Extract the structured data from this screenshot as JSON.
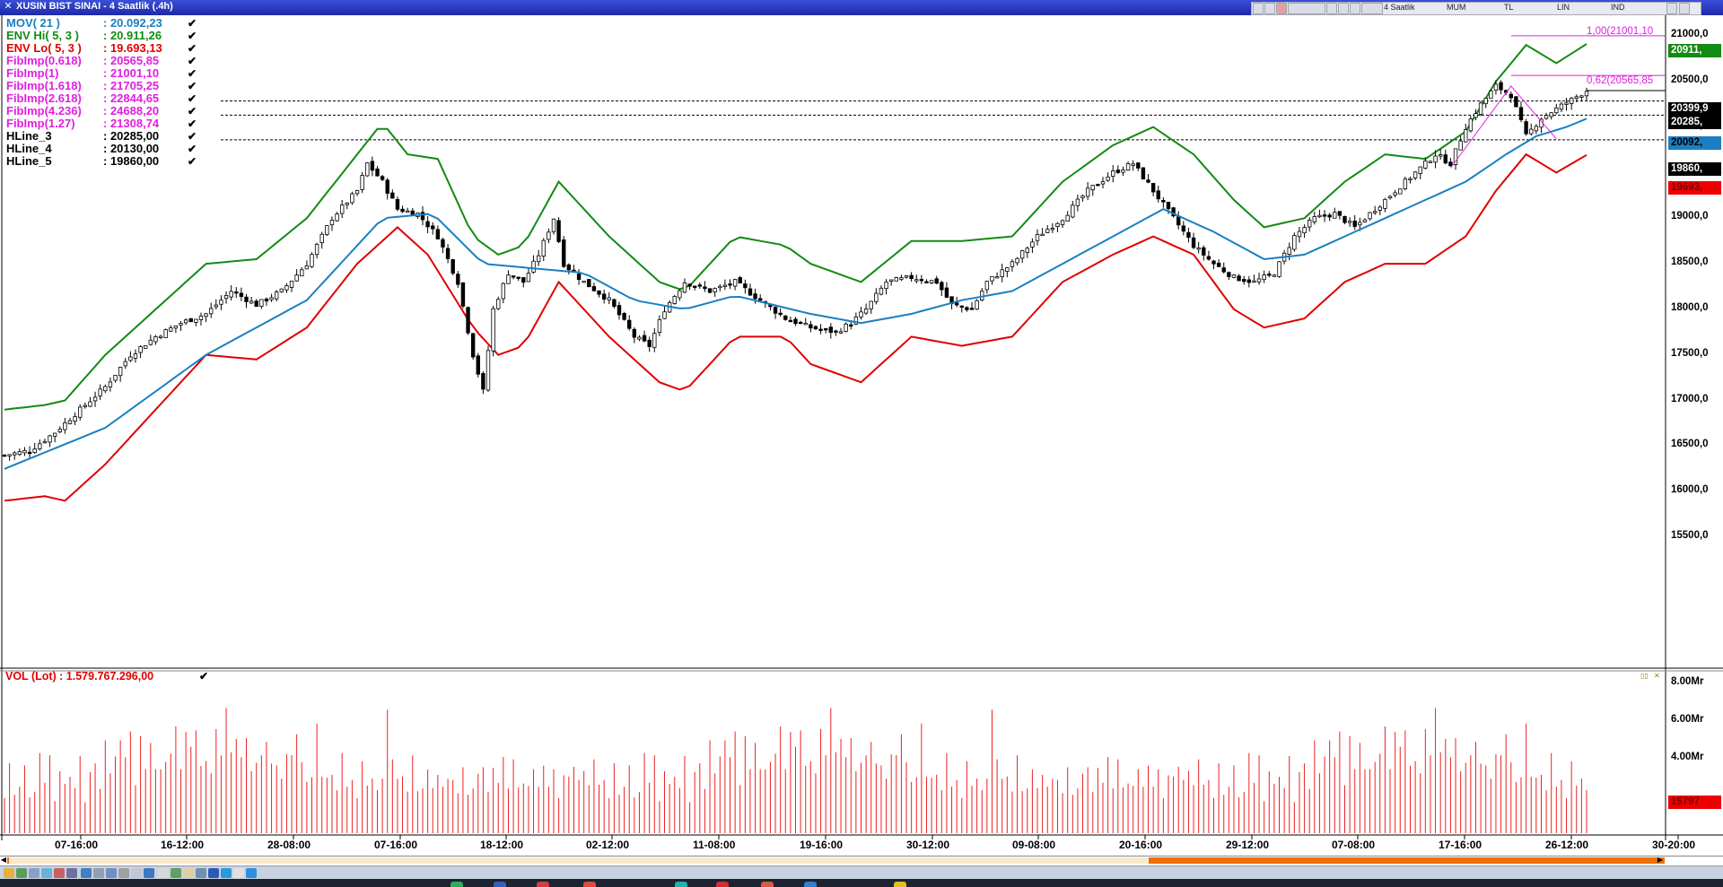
{
  "window": {
    "title": "XUSIN BIST SINAI - 4 Saatlik (.4h)",
    "toolbar_labels": [
      "4 Saatlik",
      "MUM",
      "TL",
      "LIN",
      "IND"
    ]
  },
  "legend": [
    {
      "label": "MOV( 21 )",
      "value": ": 20.092,23",
      "color": "#1a7fc2"
    },
    {
      "label": "ENV Hi( 5, 3 )",
      "value": ": 20.911,26",
      "color": "#138a13"
    },
    {
      "label": "ENV Lo( 5, 3 )",
      "value": ": 19.693,13",
      "color": "#e00000"
    },
    {
      "label": "FibImp(0.618)",
      "value": ": 20565,85",
      "color": "#e020e0"
    },
    {
      "label": "FibImp(1)",
      "value": ": 21001,10",
      "color": "#e020e0"
    },
    {
      "label": "FibImp(1.618)",
      "value": ": 21705,25",
      "color": "#e020e0"
    },
    {
      "label": "FibImp(2.618)",
      "value": ": 22844,65",
      "color": "#e020e0"
    },
    {
      "label": "FibImp(4.236)",
      "value": ": 24688,20",
      "color": "#e020e0"
    },
    {
      "label": "FibImp(1.27)",
      "value": ": 21308,74",
      "color": "#e020e0"
    },
    {
      "label": "HLine_3",
      "value": ": 20285,00",
      "color": "#000000"
    },
    {
      "label": "HLine_4",
      "value": ": 20130,00",
      "color": "#000000"
    },
    {
      "label": "HLine_5",
      "value": ": 19860,00",
      "color": "#000000"
    }
  ],
  "fib_labels": [
    "1,00(21001,10",
    "0,62(20565,85"
  ],
  "price_boxes": [
    {
      "text": "20911,",
      "bg": "#138a13",
      "fg": "#ffffff"
    },
    {
      "text": "20399,9",
      "bg": "#000000",
      "fg": "#ffffff"
    },
    {
      "text": "20285,",
      "bg": "#000000",
      "fg": "#ffffff"
    },
    {
      "text": "20092,",
      "bg": "#1a7fc2",
      "fg": "#000000"
    },
    {
      "text": "19860,",
      "bg": "#000000",
      "fg": "#ffffff"
    },
    {
      "text": "19693,",
      "bg": "#ee0000",
      "fg": "#7a0000"
    }
  ],
  "volume": {
    "legend": "VOL (Lot) : 1.579.767.296,00",
    "axis_labels": [
      "8.00Mr",
      "6.00Mr",
      "4.00Mr"
    ],
    "last_box": "15797"
  },
  "chart_data": {
    "type": "candlestick",
    "title": "XUSIN BIST SINAI - 4 Saatlik (.4h)",
    "price_axis": {
      "labels": [
        "21000,0",
        "20500,0",
        "20000,0",
        "19500,0",
        "19000,0",
        "18500,0",
        "18000,0",
        "17500,0",
        "17000,0",
        "16500,0",
        "16000,0",
        "15500,0"
      ],
      "ylim": [
        15400,
        21500
      ]
    },
    "x_tick_labels": [
      "07-16:00",
      "16-12:00",
      "28-08:00",
      "07-16:00",
      "18-12:00",
      "02-12:00",
      "11-08:00",
      "19-16:00",
      "30-12:00",
      "09-08:00",
      "20-16:00",
      "29-12:00",
      "07-08:00",
      "17-16:00",
      "26-12:00",
      "30-20:00"
    ],
    "close_path": [
      [
        0,
        16400
      ],
      [
        5,
        16450
      ],
      [
        10,
        16650
      ],
      [
        15,
        16900
      ],
      [
        20,
        17150
      ],
      [
        25,
        17500
      ],
      [
        30,
        17700
      ],
      [
        35,
        17850
      ],
      [
        40,
        17950
      ],
      [
        45,
        18200
      ],
      [
        50,
        18050
      ],
      [
        55,
        18200
      ],
      [
        60,
        18500
      ],
      [
        65,
        19000
      ],
      [
        70,
        19300
      ],
      [
        72,
        19600
      ],
      [
        75,
        19400
      ],
      [
        78,
        19100
      ],
      [
        82,
        19050
      ],
      [
        86,
        18800
      ],
      [
        90,
        18300
      ],
      [
        93,
        17500
      ],
      [
        95,
        17100
      ],
      [
        97,
        18000
      ],
      [
        100,
        18400
      ],
      [
        103,
        18300
      ],
      [
        106,
        18600
      ],
      [
        109,
        19000
      ],
      [
        111,
        18500
      ],
      [
        115,
        18300
      ],
      [
        120,
        18100
      ],
      [
        125,
        17700
      ],
      [
        128,
        17600
      ],
      [
        131,
        18000
      ],
      [
        135,
        18300
      ],
      [
        140,
        18200
      ],
      [
        145,
        18300
      ],
      [
        150,
        18100
      ],
      [
        155,
        17900
      ],
      [
        160,
        17800
      ],
      [
        165,
        17750
      ],
      [
        168,
        17850
      ],
      [
        171,
        18000
      ],
      [
        175,
        18300
      ],
      [
        180,
        18350
      ],
      [
        185,
        18300
      ],
      [
        188,
        18050
      ],
      [
        192,
        18000
      ],
      [
        195,
        18300
      ],
      [
        200,
        18500
      ],
      [
        205,
        18800
      ],
      [
        210,
        19000
      ],
      [
        215,
        19300
      ],
      [
        220,
        19500
      ],
      [
        224,
        19600
      ],
      [
        228,
        19300
      ],
      [
        232,
        19000
      ],
      [
        236,
        18700
      ],
      [
        240,
        18500
      ],
      [
        244,
        18350
      ],
      [
        248,
        18300
      ],
      [
        252,
        18400
      ],
      [
        256,
        18800
      ],
      [
        260,
        19000
      ],
      [
        264,
        19050
      ],
      [
        268,
        18900
      ],
      [
        272,
        19100
      ],
      [
        276,
        19300
      ],
      [
        280,
        19500
      ],
      [
        284,
        19700
      ],
      [
        287,
        19600
      ],
      [
        290,
        20000
      ],
      [
        293,
        20250
      ],
      [
        296,
        20450
      ],
      [
        299,
        20350
      ],
      [
        302,
        19900
      ],
      [
        305,
        20100
      ],
      [
        308,
        20200
      ],
      [
        311,
        20300
      ],
      [
        314,
        20400
      ]
    ],
    "mov_path": [
      [
        0,
        16250
      ],
      [
        20,
        16700
      ],
      [
        40,
        17500
      ],
      [
        60,
        18100
      ],
      [
        75,
        19000
      ],
      [
        85,
        19050
      ],
      [
        95,
        18500
      ],
      [
        105,
        18450
      ],
      [
        115,
        18400
      ],
      [
        125,
        18100
      ],
      [
        135,
        18000
      ],
      [
        145,
        18150
      ],
      [
        160,
        17950
      ],
      [
        170,
        17850
      ],
      [
        180,
        17950
      ],
      [
        190,
        18100
      ],
      [
        200,
        18200
      ],
      [
        210,
        18500
      ],
      [
        220,
        18800
      ],
      [
        230,
        19100
      ],
      [
        240,
        18850
      ],
      [
        250,
        18550
      ],
      [
        258,
        18600
      ],
      [
        266,
        18800
      ],
      [
        274,
        19000
      ],
      [
        282,
        19200
      ],
      [
        290,
        19400
      ],
      [
        298,
        19700
      ],
      [
        304,
        19900
      ],
      [
        310,
        20000
      ],
      [
        314,
        20092
      ]
    ],
    "env_hi_path": [
      [
        0,
        16900
      ],
      [
        8,
        16950
      ],
      [
        12,
        17000
      ],
      [
        20,
        17500
      ],
      [
        30,
        18000
      ],
      [
        40,
        18500
      ],
      [
        50,
        18550
      ],
      [
        60,
        19000
      ],
      [
        70,
        19700
      ],
      [
        75,
        20050
      ],
      [
        80,
        19700
      ],
      [
        86,
        19650
      ],
      [
        93,
        18800
      ],
      [
        98,
        18600
      ],
      [
        103,
        18700
      ],
      [
        110,
        19400
      ],
      [
        120,
        18800
      ],
      [
        130,
        18300
      ],
      [
        135,
        18200
      ],
      [
        145,
        18800
      ],
      [
        155,
        18700
      ],
      [
        160,
        18500
      ],
      [
        170,
        18300
      ],
      [
        180,
        18750
      ],
      [
        190,
        18750
      ],
      [
        200,
        18800
      ],
      [
        210,
        19400
      ],
      [
        220,
        19800
      ],
      [
        228,
        20000
      ],
      [
        236,
        19700
      ],
      [
        244,
        19200
      ],
      [
        250,
        18900
      ],
      [
        258,
        19000
      ],
      [
        266,
        19400
      ],
      [
        274,
        19700
      ],
      [
        282,
        19650
      ],
      [
        290,
        19950
      ],
      [
        296,
        20500
      ],
      [
        302,
        20900
      ],
      [
        308,
        20700
      ],
      [
        314,
        20911
      ]
    ],
    "env_lo_path": [
      [
        0,
        15900
      ],
      [
        8,
        15950
      ],
      [
        12,
        15900
      ],
      [
        20,
        16300
      ],
      [
        30,
        16900
      ],
      [
        40,
        17500
      ],
      [
        50,
        17450
      ],
      [
        60,
        17800
      ],
      [
        70,
        18500
      ],
      [
        78,
        18900
      ],
      [
        84,
        18600
      ],
      [
        93,
        17800
      ],
      [
        98,
        17500
      ],
      [
        103,
        17600
      ],
      [
        110,
        18300
      ],
      [
        120,
        17700
      ],
      [
        130,
        17200
      ],
      [
        135,
        17100
      ],
      [
        145,
        17700
      ],
      [
        155,
        17700
      ],
      [
        160,
        17400
      ],
      [
        170,
        17200
      ],
      [
        180,
        17700
      ],
      [
        190,
        17600
      ],
      [
        200,
        17700
      ],
      [
        210,
        18300
      ],
      [
        220,
        18600
      ],
      [
        228,
        18800
      ],
      [
        236,
        18600
      ],
      [
        244,
        18000
      ],
      [
        250,
        17800
      ],
      [
        258,
        17900
      ],
      [
        266,
        18300
      ],
      [
        274,
        18500
      ],
      [
        282,
        18500
      ],
      [
        290,
        18800
      ],
      [
        296,
        19300
      ],
      [
        302,
        19700
      ],
      [
        308,
        19500
      ],
      [
        314,
        19693
      ]
    ],
    "hlines": [
      20285,
      20130,
      19860
    ],
    "fib_levels": [
      21001.1,
      20565.85
    ],
    "volume_series": [
      2.2,
      3.5,
      2.1,
      2.8,
      3.3,
      1.9,
      2.4,
      3.8,
      2.6,
      4.4,
      2.0,
      3.1,
      2.7,
      3.4,
      2.2,
      4.1,
      1.8,
      2.9,
      3.6,
      2.5,
      5.8,
      3.0,
      4.2,
      5.6,
      3.7,
      5.4,
      2.8,
      4.6,
      3.3,
      5.1,
      4.0,
      3.2,
      3.9,
      4.8,
      5.2,
      3.4,
      5.9,
      4.1,
      5.3,
      3.8,
      4.5,
      3.0,
      5.7,
      4.7,
      6.1,
      4.3,
      5.5,
      3.6,
      4.9,
      3.5,
      4.4,
      3.9,
      5.0,
      4.2,
      3.3,
      2.9,
      4.6,
      3.7,
      5.1,
      4.0,
      3.2,
      2.8,
      6.0,
      3.4,
      2.7,
      3.1,
      2.5,
      3.8,
      2.4,
      3.0,
      2.2,
      3.6,
      2.6,
      3.3,
      2.1,
      2.9,
      7.2,
      3.5,
      2.8,
      3.2,
      2.6,
      3.9,
      2.3,
      2.7,
      3.1,
      2.4,
      3.4,
      2.2,
      2.8,
      3.0,
      2.5,
      3.3,
      2.1,
      2.7,
      2.9,
      3.5,
      2.4,
      3.1,
      2.6,
      4.3,
      2.8,
      3.7,
      2.5,
      3.0,
      2.3,
      3.4,
      2.7,
      3.2,
      2.4,
      3.6,
      2.2,
      2.9,
      3.1,
      4.0,
      2.6,
      3.3,
      2.8,
      3.5,
      2.5,
      3.0
    ]
  }
}
